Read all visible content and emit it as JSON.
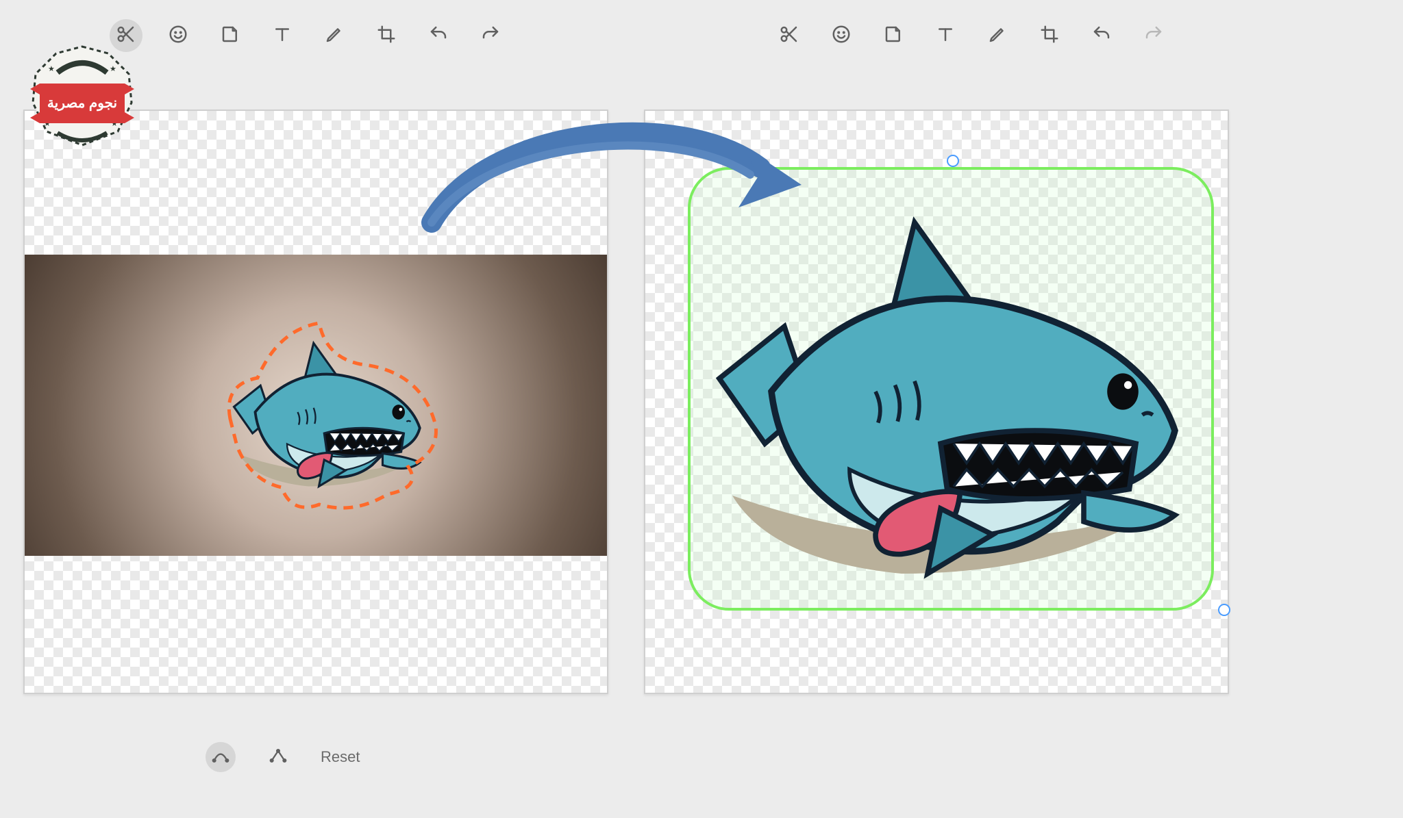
{
  "toolbars": {
    "left": {
      "tools": [
        "cut",
        "emoji",
        "sticker",
        "text",
        "draw",
        "crop",
        "undo",
        "redo"
      ],
      "active": "cut",
      "disabled": []
    },
    "right": {
      "tools": [
        "cut",
        "emoji",
        "sticker",
        "text",
        "draw",
        "crop",
        "undo",
        "redo"
      ],
      "active": null,
      "disabled": [
        "redo"
      ]
    }
  },
  "logo": {
    "ribbon_text": "نجوم مصرية"
  },
  "subtoolbar": {
    "modes": [
      "curve",
      "polyline"
    ],
    "active": "curve",
    "reset_label": "Reset"
  },
  "left_canvas": {
    "content": "shark-cartoon-on-beige-vignette",
    "lasso_selection": true
  },
  "right_canvas": {
    "content": "shark-cartoon-cutout",
    "sticker_selected": true,
    "selection_color": "#7ced5f"
  },
  "colors": {
    "toolbar_icon": "#606060",
    "toolbar_icon_disabled": "#b8b8b8",
    "toolbar_active_bg": "#d6d6d6",
    "page_bg": "#ececec",
    "arrow": "#4a79b5",
    "selection_green": "#7ced5f",
    "lasso_orange": "#ff6a2b",
    "logo_ribbon": "#d83a3a",
    "shark_body": "#51adbf",
    "shark_belly": "#cde9ec",
    "shark_tongue": "#e25a74"
  }
}
